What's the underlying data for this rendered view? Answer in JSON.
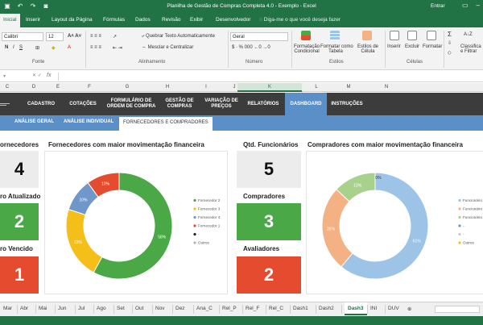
{
  "titlebar": {
    "title": "Planilha de Gestão de Compras Completa 4.0 - Exemplo  -  Excel",
    "sign_in": "Entrar"
  },
  "menu": {
    "tabs": [
      "Inicial",
      "Inserir",
      "Layout da Página",
      "Fórmulas",
      "Dados",
      "Revisão",
      "Exibir",
      "Desenvolvedor"
    ],
    "tell_me": "Diga-me o que você deseja fazer"
  },
  "ribbon": {
    "font_name": "Calibri",
    "font_size": "12",
    "wrap_text": "Quebrar Texto Automaticamente",
    "merge_center": "Mesclar e Centralizar",
    "number_format": "Geral",
    "cond_format": [
      "Formatação",
      "Condicional"
    ],
    "format_table": [
      "Formatar como",
      "Tabela"
    ],
    "cell_styles": [
      "Estilos de",
      "Célula"
    ],
    "insert": "Inserir",
    "delete": "Excluir",
    "format": "Formatar",
    "sort": [
      "Classifica",
      "e Filtrar"
    ],
    "groups": {
      "font": "Fonte",
      "alignment": "Alinhamento",
      "number": "Número",
      "styles": "Estilos",
      "cells": "Células"
    }
  },
  "columns": [
    "C",
    "D",
    "E",
    "F",
    "G",
    "H",
    "I",
    "J",
    "K",
    "L",
    "M",
    "N"
  ],
  "nav": {
    "items": [
      "CADASTRO",
      "COTAÇÕES",
      "FORMULÁRIO DE ORDEM DE COMPRA",
      "GESTÃO DE COMPRAS",
      "VARIAÇÃO DE PREÇOS",
      "RELATÓRIOS",
      "DASHBOARD",
      "INSTRUÇÕES"
    ],
    "sub": [
      "ANÁLISE GERAL",
      "ANÁLISE INDIVIDUAL",
      "FORNECEDORES E COMPRADORES"
    ]
  },
  "dashboard": {
    "left_stats": [
      {
        "label": "ornecedores",
        "value": "4"
      },
      {
        "label": "ro Atualizado",
        "value": "2"
      },
      {
        "label": "ro Vencido",
        "value": "1"
      }
    ],
    "mid_stats": [
      {
        "label": "Qtd. Funcionários",
        "value": "5"
      },
      {
        "label": "Compradores",
        "value": "3"
      },
      {
        "label": "Avaliadores",
        "value": "2"
      }
    ],
    "chart1_title": "Fornecedores com maior movimentação financeira",
    "chart2_title": "Compradores com maior movimentação financeira"
  },
  "chart_data": [
    {
      "type": "pie",
      "title": "Fornecedores com maior movimentação financeira",
      "labels": [
        "Fornecedor 2",
        "Fornecedor 3",
        "Fornecedor 4",
        "Fornecedor 1",
        "-",
        "Outros"
      ],
      "values": [
        58,
        22,
        10,
        10,
        0,
        0
      ],
      "value_labels": [
        "58%",
        "22%",
        "10%",
        "10%",
        "",
        ""
      ],
      "colors": [
        "#4aa846",
        "#f5bf1a",
        "#6f97c9",
        "#e54b2e",
        "#222222",
        "#b4b4b4"
      ],
      "legend": "right"
    },
    {
      "type": "pie",
      "title": "Compradores com maior movimentação financeira",
      "labels": [
        "Funcionário",
        "Funcionário",
        "Funcionário",
        "-",
        "-",
        "Outros"
      ],
      "values": [
        61,
        26,
        13,
        0,
        0,
        0
      ],
      "value_labels": [
        "61%",
        "26%",
        "13%",
        "0%",
        "",
        ""
      ],
      "colors": [
        "#9dc3e6",
        "#f4b183",
        "#a9d18e",
        "#6f97c9",
        "#c9c9c9",
        "#f5bf1a"
      ],
      "legend": "right"
    }
  ],
  "sheets": [
    "Mar",
    "Abr",
    "Mai",
    "Jun",
    "Jul",
    "Ago",
    "Set",
    "Out",
    "Nov",
    "Dez",
    "Ana_C",
    "Rel_P",
    "Rel_F",
    "Rel_C",
    "Dash1",
    "Dash2",
    "Dash3",
    "INI",
    "DUV"
  ],
  "active_sheet": "Dash3"
}
